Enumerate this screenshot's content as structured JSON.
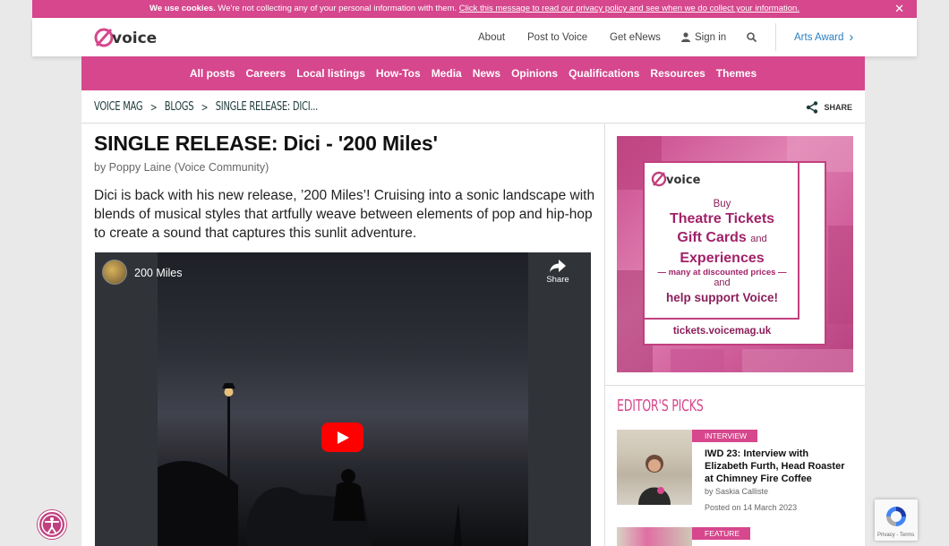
{
  "cookie_bar": {
    "bold": "We use cookies.",
    "text": " We're not collecting any of your personal information with them. ",
    "link": "Click this message to read our privacy policy and see when we do collect your information.",
    "close": "✕"
  },
  "header": {
    "logo_text": "voice",
    "nav": [
      "About",
      "Post to Voice",
      "Get eNews",
      "Sign in"
    ],
    "arts_award": "Arts Award",
    "arts_award_chevron": "›"
  },
  "main_nav": [
    "All posts",
    "Careers",
    "Local listings",
    "How-Tos",
    "Media",
    "News",
    "Opinions",
    "Qualifications",
    "Resources",
    "Themes"
  ],
  "breadcrumb": [
    "VOICE MAG",
    "BLOGS",
    "SINGLE RELEASE: DICI..."
  ],
  "breadcrumb_sep": ">",
  "share_label": "SHARE",
  "article": {
    "title": "SINGLE RELEASE: Dici - '200 Miles'",
    "byline": "by Poppy Laine (Voice Community)",
    "lead": "Dici is back with his new release, ’200 Miles’! Cruising into a sonic landscape with blends of musical styles that artfully weave between elements of pop and hip-hop to create a sound that captures this sunlit adventure."
  },
  "video": {
    "title": "200 Miles",
    "share": "Share"
  },
  "ad": {
    "logo_text": "voice",
    "buy": "Buy",
    "line1": "Theatre Tickets",
    "line2a": "Gift Cards",
    "line2b": "and",
    "line3": "Experiences",
    "discount": "— many at discounted prices —",
    "and": "and",
    "support": "help support Voice!",
    "url": "tickets.voicemag.uk"
  },
  "editors_picks": {
    "heading": "EDITOR'S PICKS",
    "items": [
      {
        "tag": "INTERVIEW",
        "title": "IWD 23: Interview with Elizabeth Furth, Head Roaster at Chimney Fire Coffee",
        "author": "by Saskia Calliste",
        "date": "Posted on 14 March 2023"
      },
      {
        "tag": "FEATURE"
      }
    ]
  },
  "recaptcha": {
    "text": "Privacy - Terms"
  },
  "colors": {
    "brand_pink": "#d6478d",
    "link_blue": "#2a7fc1",
    "dark_teal": "#1f3b3b"
  }
}
